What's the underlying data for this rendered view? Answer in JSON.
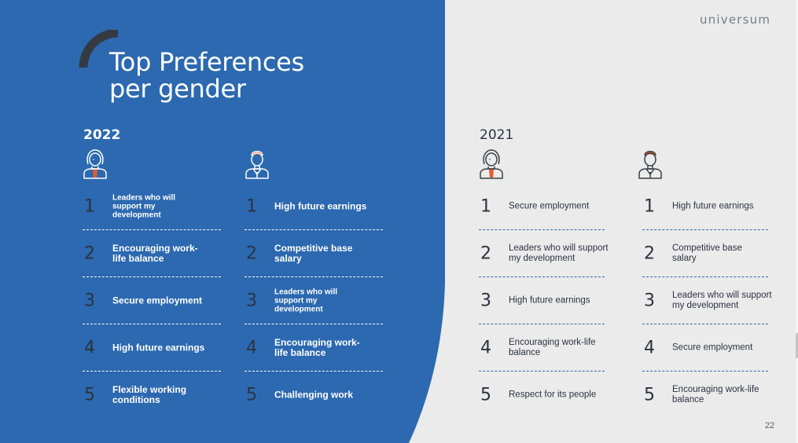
{
  "colors": {
    "blue_panel": "#2c69b0",
    "grey_bg": "#ebebeb",
    "accent_orange": "#e85a2a",
    "dark_text": "#2b3340",
    "arc": "#353a42"
  },
  "header": {
    "title_line1": "Top Preferences",
    "title_line2": "per gender",
    "logo": "universum"
  },
  "page_number": "22",
  "panels": {
    "y2022": {
      "year": "2022",
      "female": {
        "icon": "female-avatar-icon",
        "items": [
          {
            "rank": "1",
            "label": "Leaders who will support my development"
          },
          {
            "rank": "2",
            "label": "Encouraging work-life balance"
          },
          {
            "rank": "3",
            "label": "Secure employment"
          },
          {
            "rank": "4",
            "label": "High future earnings"
          },
          {
            "rank": "5",
            "label": "Flexible working conditions"
          }
        ]
      },
      "male": {
        "icon": "male-avatar-icon",
        "items": [
          {
            "rank": "1",
            "label": "High future earnings"
          },
          {
            "rank": "2",
            "label": "Competitive base salary"
          },
          {
            "rank": "3",
            "label": "Leaders who will support my development"
          },
          {
            "rank": "4",
            "label": "Encouraging work-life balance"
          },
          {
            "rank": "5",
            "label": "Challenging work"
          }
        ]
      }
    },
    "y2021": {
      "year": "2021",
      "female": {
        "icon": "female-avatar-icon",
        "items": [
          {
            "rank": "1",
            "label": "Secure employment"
          },
          {
            "rank": "2",
            "label": "Leaders who will support my development"
          },
          {
            "rank": "3",
            "label": "High future earnings"
          },
          {
            "rank": "4",
            "label": "Encouraging work-life balance"
          },
          {
            "rank": "5",
            "label": "Respect for its people"
          }
        ]
      },
      "male": {
        "icon": "male-avatar-icon",
        "items": [
          {
            "rank": "1",
            "label": "High future earnings"
          },
          {
            "rank": "2",
            "label": "Competitive base salary"
          },
          {
            "rank": "3",
            "label": "Leaders who will support my development"
          },
          {
            "rank": "4",
            "label": "Secure employment"
          },
          {
            "rank": "5",
            "label": "Encouraging work-life balance"
          }
        ]
      }
    }
  }
}
